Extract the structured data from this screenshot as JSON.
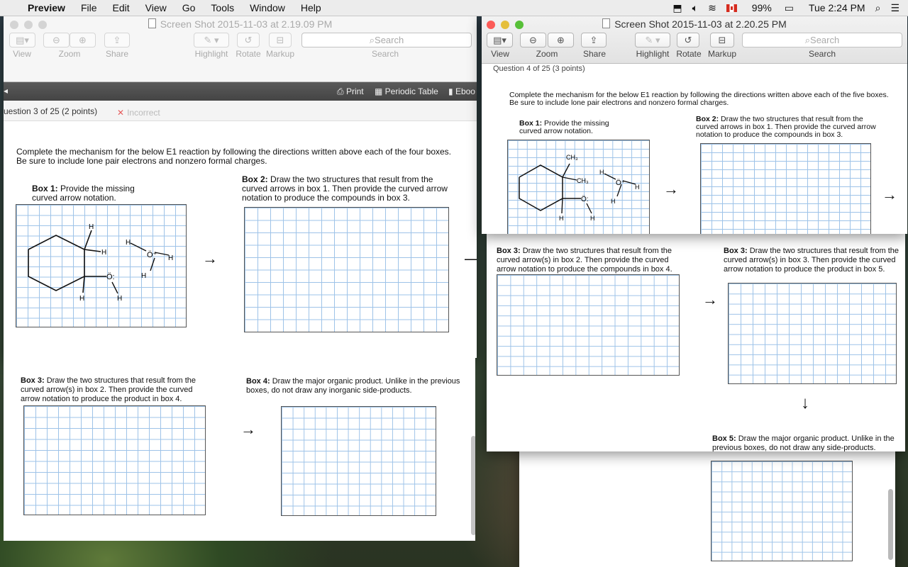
{
  "menubar": {
    "app_name": "Preview",
    "items": [
      "File",
      "Edit",
      "View",
      "Go",
      "Tools",
      "Window",
      "Help"
    ],
    "battery": "99%",
    "clock": "Tue 2:24 PM"
  },
  "window1": {
    "title": "Screen Shot 2015-11-03 at 2.19.09 PM",
    "toolbar": {
      "view": "View",
      "zoom": "Zoom",
      "share": "Share",
      "highlight": "Highlight",
      "rotate": "Rotate",
      "markup": "Markup",
      "search_placeholder": "Search",
      "search_label": "Search"
    },
    "doc": {
      "print": "Print",
      "periodic": "Periodic Table",
      "ebook": "Eboo",
      "question": "uestion 3 of 25 (2 points)",
      "status": "Incorrect",
      "instructions": "Complete the mechanism for the below E1 reaction by following the directions written above each of the four boxes. Be sure to include lone pair electrons and nonzero formal charges.",
      "box1_head": "Box 1:",
      "box1_text": "Provide the missing curved arrow notation.",
      "box2_head": "Box 2:",
      "box2_text": "Draw the two structures that result from the curved arrows in box 1. Then provide the curved arrow notation to produce the compounds in box 3.",
      "box3_head": "Box 3:",
      "box3_text": "Draw the two structures that result from the curved arrow(s) in box 2. Then provide the curved arrow notation to produce the product in box 4.",
      "box4_head": "Box 4:",
      "box4_text": "Draw the major organic product. Unlike in the previous boxes, do not draw any inorganic side-products."
    }
  },
  "window2": {
    "title": "Screen Shot 2015-11-03 at 2.20.25 PM",
    "toolbar": {
      "view": "View",
      "zoom": "Zoom",
      "share": "Share",
      "highlight": "Highlight",
      "rotate": "Rotate",
      "markup": "Markup",
      "search_placeholder": "Search",
      "search_label": "Search"
    },
    "doc": {
      "question": "Question 4 of 25 (3 points)",
      "instructions": "Complete the mechanism for the below E1 reaction by following the directions written above each of the five boxes. Be sure to include lone pair electrons and nonzero formal charges.",
      "box1_head": "Box 1:",
      "box1_text": "Provide the missing curved arrow notation.",
      "box2_head": "Box 2:",
      "box2_text": "Draw the two structures that result from the curved arrows in box 1. Then provide the curved arrow notation to produce the compounds in box 3."
    }
  },
  "window3": {
    "box3a_head": "Box 3:",
    "box3a_text": "Draw the two structures that result from the curved arrow(s) in box 2. Then provide the curved arrow notation to produce the compounds in box 4.",
    "box3b_head": "Box 3:",
    "box3b_text": "Draw the two structures that result from the curved arrow(s) in box 3. Then provide the curved arrow notation to produce the product in box 5.",
    "box5_head": "Box 5:",
    "box5_text": "Draw the major organic product. Unlike in the previous boxes, do not draw any side-products."
  },
  "molecule_labels": {
    "h": "H",
    "ch3": "CH₃",
    "o_lone": "Ö:",
    "o_plus": "Ö⁺"
  }
}
